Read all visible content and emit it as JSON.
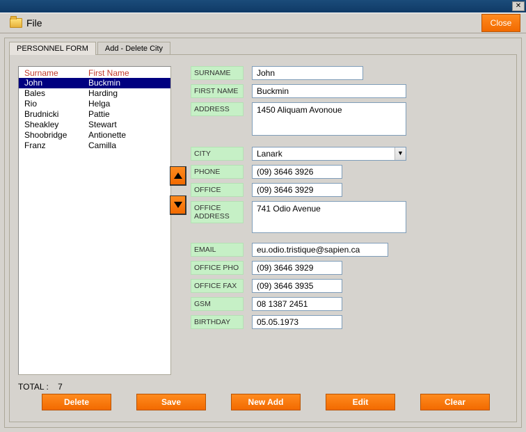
{
  "menu": {
    "file_label": "File"
  },
  "close_label": "Close",
  "tabs": {
    "personnel": "PERSONNEL FORM",
    "city": "Add - Delete City"
  },
  "list": {
    "header_surname": "Surname",
    "header_firstname": "First Name",
    "rows": [
      {
        "surname": "John",
        "firstname": "Buckmin",
        "selected": true
      },
      {
        "surname": "Bales",
        "firstname": "Harding"
      },
      {
        "surname": "Rio",
        "firstname": "Helga"
      },
      {
        "surname": "Brudnicki",
        "firstname": "Pattie"
      },
      {
        "surname": "Sheakley",
        "firstname": "Stewart"
      },
      {
        "surname": "Shoobridge",
        "firstname": "Antionette"
      },
      {
        "surname": "Franz",
        "firstname": "Camilla"
      }
    ]
  },
  "labels": {
    "surname": "SURNAME",
    "firstname": "FIRST NAME",
    "address": "ADDRESS",
    "city": "CITY",
    "phone": "PHONE",
    "office": "OFFICE",
    "office_address": "OFFICE ADDRESS",
    "email": "EMAIL",
    "office_pho": "OFFICE PHO",
    "office_fax": "OFFICE FAX",
    "gsm": "GSM",
    "birthday": "BIRTHDAY"
  },
  "values": {
    "surname": "John",
    "firstname": "Buckmin",
    "address": "1450 Aliquam Avonoue",
    "city": "Lanark",
    "phone": "(09) 3646 3926",
    "office": "(09) 3646 3929",
    "office_address": "741 Odio Avenue",
    "email": "eu.odio.tristique@sapien.ca",
    "office_pho": "(09) 3646 3929",
    "office_fax": "(09) 3646 3935",
    "gsm": "08 1387 2451",
    "birthday": "05.05.1973"
  },
  "total": {
    "label": "TOTAL :",
    "value": "7"
  },
  "buttons": {
    "delete": "Delete",
    "save": "Save",
    "newadd": "New Add",
    "edit": "Edit",
    "clear": "Clear"
  }
}
